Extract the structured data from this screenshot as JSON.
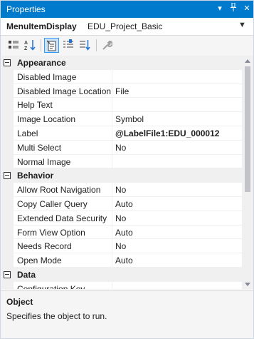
{
  "window": {
    "title": "Properties"
  },
  "object": {
    "name": "MenuItemDisplay",
    "type": "EDU_Project_Basic"
  },
  "toolbar": {
    "buttons": [
      {
        "icon": "categorized-icon"
      },
      {
        "icon": "alphabetical-icon"
      },
      {
        "icon": "properties-icon",
        "active": true
      },
      {
        "icon": "events-icon"
      },
      {
        "icon": "property-pages-icon"
      },
      {
        "icon": "wrench-icon"
      }
    ]
  },
  "grid": {
    "categories": [
      {
        "label": "Appearance",
        "rows": [
          {
            "name": "Disabled Image",
            "value": ""
          },
          {
            "name": "Disabled Image Location",
            "value": "File"
          },
          {
            "name": "Help Text",
            "value": ""
          },
          {
            "name": "Image Location",
            "value": "Symbol"
          },
          {
            "name": "Label",
            "value": "@LabelFile1:EDU_000012",
            "bold": true
          },
          {
            "name": "Multi Select",
            "value": "No"
          },
          {
            "name": "Normal Image",
            "value": ""
          }
        ]
      },
      {
        "label": "Behavior",
        "rows": [
          {
            "name": "Allow Root Navigation",
            "value": "No"
          },
          {
            "name": "Copy Caller Query",
            "value": "Auto"
          },
          {
            "name": "Extended Data Security",
            "value": "No"
          },
          {
            "name": "Form View Option",
            "value": "Auto"
          },
          {
            "name": "Needs Record",
            "value": "No"
          },
          {
            "name": "Open Mode",
            "value": "Auto"
          }
        ]
      },
      {
        "label": "Data",
        "rows": [
          {
            "name": "Configuration Key",
            "value": ""
          }
        ]
      }
    ]
  },
  "description": {
    "title": "Object",
    "text": "Specifies the object to run."
  },
  "colors": {
    "accent": "#007acc",
    "category_bg": "#f0f0f0"
  }
}
